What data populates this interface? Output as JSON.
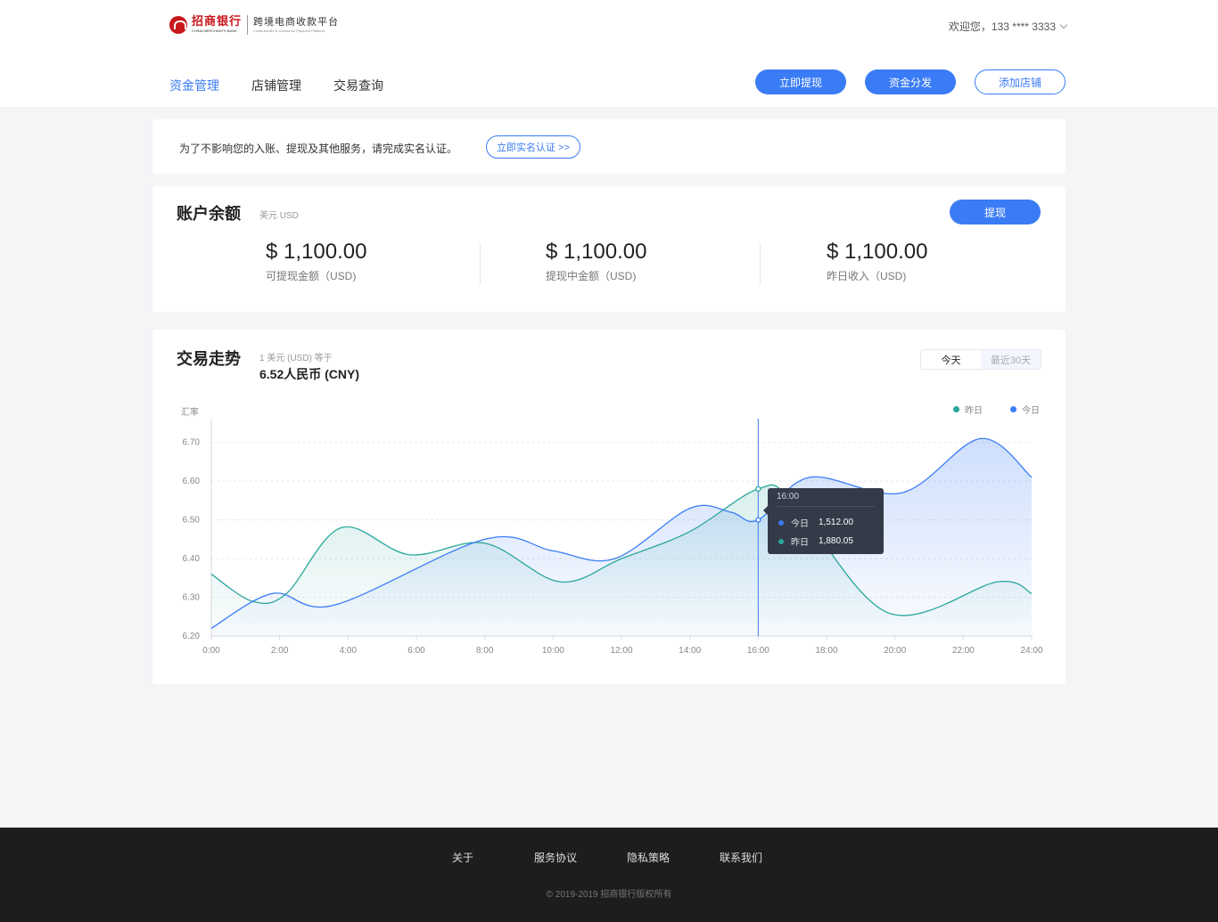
{
  "header": {
    "bank_name": "招商银行",
    "bank_name_en": "CHINA MERCHANTS BANK",
    "platform_name": "跨境电商收款平台",
    "platform_name_en": "Cross-border E-commerce Payment Platform",
    "welcome": "欢迎您，133 **** 3333"
  },
  "nav": {
    "items": [
      "资金管理",
      "店铺管理",
      "交易查询"
    ],
    "active": 0
  },
  "actions": {
    "withdraw_now": "立即提现",
    "distribute": "资金分发",
    "add_store": "添加店铺"
  },
  "notice": {
    "text": "为了不影响您的入账、提现及其他服务，请完成实名认证。",
    "button": "立即实名认证 >>"
  },
  "balance": {
    "title": "账户余额",
    "currency": "美元 USD",
    "withdraw_button": "提现",
    "items": [
      {
        "amount": "$ 1,100.00",
        "label": "可提现金额（USD)"
      },
      {
        "amount": "$ 1,100.00",
        "label": "提现中金额（USD)"
      },
      {
        "amount": "$ 1,100.00",
        "label": "昨日收入（USD)"
      }
    ]
  },
  "trend": {
    "title": "交易走势",
    "rate_note": "1 美元 (USD) 等于",
    "rate_value": "6.52人民币 (CNY)",
    "tabs": [
      "今天",
      "最近30天"
    ],
    "active_tab": 0,
    "tooltip": {
      "time": "16:00",
      "rows": [
        {
          "label": "今日",
          "value": "1,512.00",
          "color": "#3a7cf5"
        },
        {
          "label": "昨日",
          "value": "1,880.05",
          "color": "#2aa79b"
        }
      ]
    }
  },
  "chart_data": {
    "type": "area",
    "ylabel": "汇率",
    "ylim": [
      6.2,
      6.75
    ],
    "yticks": [
      "6.20",
      "6.30",
      "6.40",
      "6.50",
      "6.60",
      "6.70"
    ],
    "x": [
      "0:00",
      "2:00",
      "4:00",
      "6:00",
      "8:00",
      "10:00",
      "12:00",
      "14:00",
      "16:00",
      "18:00",
      "20:00",
      "22:00",
      "24:00"
    ],
    "xlim": [
      0,
      24
    ],
    "legend": "top-right",
    "crosshair_x": 16,
    "series": [
      {
        "name": "昨日",
        "color": "#2aa79b",
        "points": [
          [
            0,
            6.36
          ],
          [
            1.2,
            6.29
          ],
          [
            2.2,
            6.31
          ],
          [
            3.8,
            6.48
          ],
          [
            5.8,
            6.41
          ],
          [
            8.0,
            6.44
          ],
          [
            10.2,
            6.34
          ],
          [
            12.0,
            6.4
          ],
          [
            14.0,
            6.47
          ],
          [
            16.0,
            6.58
          ],
          [
            17.0,
            6.55
          ],
          [
            19.8,
            6.26
          ],
          [
            23.0,
            6.34
          ],
          [
            24.0,
            6.31
          ]
        ]
      },
      {
        "name": "今日",
        "color": "#3a7cf5",
        "points": [
          [
            0,
            6.22
          ],
          [
            1.8,
            6.31
          ],
          [
            3.6,
            6.28
          ],
          [
            8.0,
            6.45
          ],
          [
            10.0,
            6.42
          ],
          [
            11.8,
            6.4
          ],
          [
            14.0,
            6.53
          ],
          [
            15.2,
            6.52
          ],
          [
            16.0,
            6.5
          ],
          [
            17.5,
            6.61
          ],
          [
            20.2,
            6.57
          ],
          [
            22.5,
            6.71
          ],
          [
            24.0,
            6.61
          ]
        ]
      }
    ]
  },
  "footer": {
    "links": [
      "关于",
      "服务协议",
      "隐私策略",
      "联系我们"
    ],
    "copyright": "© 2019-2019  招商银行版权所有"
  },
  "colors": {
    "primary": "#3a7cf5",
    "teal": "#2aa79b",
    "footer_bg": "#1d1d1d",
    "page_bg": "#f4f5f7"
  }
}
